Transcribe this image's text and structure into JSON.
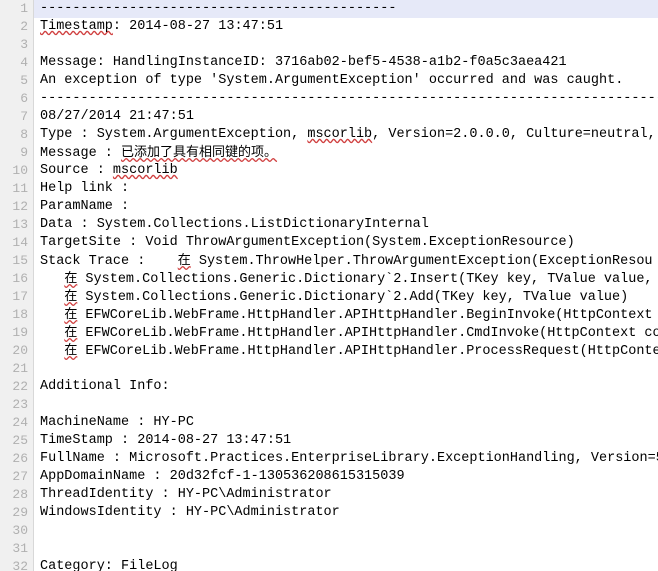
{
  "app": {
    "type": "log-file-viewer",
    "colors": {
      "background": "#ffffff",
      "gutter_background": "#f0f0f0",
      "gutter_text": "#b0b0b0",
      "gutter_border": "#d8d8d8",
      "text": "#000000",
      "highlight_line": "#e6e9f8",
      "spellcheck_underline": "#d04040"
    },
    "gutter": {
      "first_line": 1,
      "last_line": 32,
      "visible_line_count": 32
    },
    "wrap": "off",
    "highlighted_line_number": 1
  },
  "lines": [
    {
      "num": "1",
      "text": "--------------------------------------------",
      "highlight": true,
      "spell": []
    },
    {
      "num": "2",
      "text": "Timestamp: 2014-08-27 13:47:51",
      "highlight": false,
      "spell": [
        "Timestamp"
      ]
    },
    {
      "num": "3",
      "text": "",
      "highlight": false,
      "spell": []
    },
    {
      "num": "4",
      "text": "Message: HandlingInstanceID: 3716ab02-bef5-4538-a1b2-f0a5c3aea421",
      "highlight": false,
      "spell": []
    },
    {
      "num": "5",
      "text": "An exception of type 'System.ArgumentException' occurred and was caught.",
      "highlight": false,
      "spell": []
    },
    {
      "num": "6",
      "text": "------------------------------------------------------------------------------",
      "highlight": false,
      "spell": []
    },
    {
      "num": "7",
      "text": "08/27/2014 21:47:51",
      "highlight": false,
      "spell": []
    },
    {
      "num": "8",
      "text": "Type : System.ArgumentException, mscorlib, Version=2.0.0.0, Culture=neutral,",
      "highlight": false,
      "spell": [
        "mscorlib"
      ]
    },
    {
      "num": "9",
      "text": "Message : 已添加了具有相同键的项。",
      "highlight": false,
      "spell": [
        "已添加了具有相同键的项。"
      ]
    },
    {
      "num": "10",
      "text": "Source : mscorlib",
      "highlight": false,
      "spell": [
        "mscorlib"
      ]
    },
    {
      "num": "11",
      "text": "Help link : ",
      "highlight": false,
      "spell": []
    },
    {
      "num": "12",
      "text": "ParamName : ",
      "highlight": false,
      "spell": []
    },
    {
      "num": "13",
      "text": "Data : System.Collections.ListDictionaryInternal",
      "highlight": false,
      "spell": []
    },
    {
      "num": "14",
      "text": "TargetSite : Void ThrowArgumentException(System.ExceptionResource)",
      "highlight": false,
      "spell": []
    },
    {
      "num": "15",
      "text": "Stack Trace :    在 System.ThrowHelper.ThrowArgumentException(ExceptionResou",
      "highlight": false,
      "spell": [
        "在"
      ]
    },
    {
      "num": "16",
      "text": "   在 System.Collections.Generic.Dictionary`2.Insert(TKey key, TValue value,",
      "highlight": false,
      "spell": [
        "在"
      ]
    },
    {
      "num": "17",
      "text": "   在 System.Collections.Generic.Dictionary`2.Add(TKey key, TValue value)",
      "highlight": false,
      "spell": [
        "在"
      ]
    },
    {
      "num": "18",
      "text": "   在 EFWCoreLib.WebFrame.HttpHandler.APIHttpHandler.BeginInvoke(HttpContext",
      "highlight": false,
      "spell": [
        "在"
      ]
    },
    {
      "num": "19",
      "text": "   在 EFWCoreLib.WebFrame.HttpHandler.APIHttpHandler.CmdInvoke(HttpContext co",
      "highlight": false,
      "spell": [
        "在"
      ]
    },
    {
      "num": "20",
      "text": "   在 EFWCoreLib.WebFrame.HttpHandler.APIHttpHandler.ProcessRequest(HttpConte",
      "highlight": false,
      "spell": [
        "在"
      ]
    },
    {
      "num": "21",
      "text": "",
      "highlight": false,
      "spell": []
    },
    {
      "num": "22",
      "text": "Additional Info:",
      "highlight": false,
      "spell": []
    },
    {
      "num": "23",
      "text": "",
      "highlight": false,
      "spell": []
    },
    {
      "num": "24",
      "text": "MachineName : HY-PC",
      "highlight": false,
      "spell": []
    },
    {
      "num": "25",
      "text": "TimeStamp : 2014-08-27 13:47:51",
      "highlight": false,
      "spell": []
    },
    {
      "num": "26",
      "text": "FullName : Microsoft.Practices.EnterpriseLibrary.ExceptionHandling, Version=5",
      "highlight": false,
      "spell": []
    },
    {
      "num": "27",
      "text": "AppDomainName : 20d32fcf-1-130536208615315039",
      "highlight": false,
      "spell": []
    },
    {
      "num": "28",
      "text": "ThreadIdentity : HY-PC\\Administrator",
      "highlight": false,
      "spell": []
    },
    {
      "num": "29",
      "text": "WindowsIdentity : HY-PC\\Administrator",
      "highlight": false,
      "spell": []
    },
    {
      "num": "30",
      "text": "",
      "highlight": false,
      "spell": []
    },
    {
      "num": "31",
      "text": "",
      "highlight": false,
      "spell": []
    },
    {
      "num": "32",
      "text": "Category: FileLog",
      "highlight": false,
      "spell": []
    }
  ]
}
